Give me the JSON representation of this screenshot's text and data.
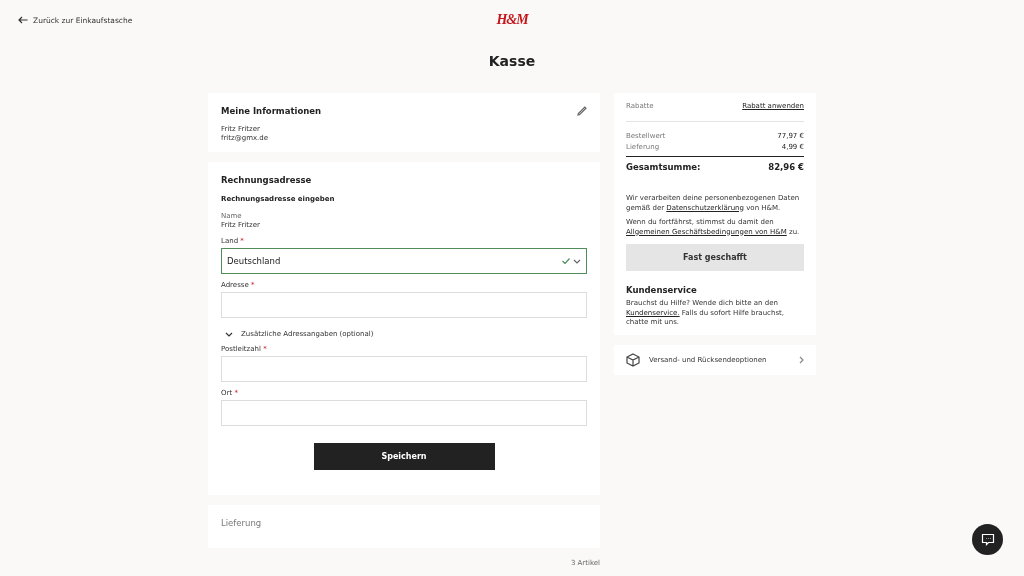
{
  "header": {
    "back_link": "Zurück zur Einkaufstasche",
    "logo": "H&M"
  },
  "page_title": "Kasse",
  "my_info": {
    "title": "Meine Informationen",
    "name": "Fritz Fritzer",
    "email": "fritz@gmx.de"
  },
  "billing": {
    "title": "Rechnungsadresse",
    "subtitle": "Rechnungsadresse eingeben",
    "name_label": "Name",
    "name_value": "Fritz Fritzer",
    "fields": [
      {
        "kind": "select",
        "label": "Land",
        "required_mark": "*",
        "value": "Deutschland",
        "valid": true
      },
      {
        "kind": "text",
        "label": "Adresse",
        "required_mark": "*"
      },
      {
        "kind": "toggle",
        "label": "Zusätzliche Adressangaben (optional)",
        "expanded": false
      },
      {
        "kind": "text",
        "label": "Postleitzahl",
        "required_mark": "*"
      },
      {
        "kind": "text",
        "label": "Ort",
        "required_mark": "*"
      }
    ],
    "save_button": "Speichern"
  },
  "delivery": {
    "title": "Lieferung"
  },
  "order_items": {
    "count": "3 Artikel"
  },
  "summary": {
    "discount_label": "Rabatte",
    "discount_link": "Rabatt anwenden",
    "lines": [
      {
        "label": "Bestellwert",
        "value": "77,97 €"
      },
      {
        "label": "Lieferung",
        "value": "4,99 €"
      }
    ],
    "total_label": "Gesamtsumme:",
    "total_value": "82,96 €",
    "notes": [
      [
        {
          "text": "Wir verarbeiten deine personenbezogenen Daten gemäß der "
        },
        {
          "text": "Datenschutzerklärung",
          "link": true
        },
        {
          "text": " von H&M."
        }
      ],
      [
        {
          "text": "Wenn du fortfährst, stimmst du damit den "
        },
        {
          "text": "Allgemeinen Geschäftsbedingungen von H&M",
          "link": true
        },
        {
          "text": " zu."
        }
      ]
    ],
    "continue_button": "Fast geschafft",
    "service_title": "Kundenservice",
    "service_text": [
      {
        "text": "Brauchst du Hilfe? Wende dich bitte an den "
      },
      {
        "text": "Kundenservice.",
        "link": true
      },
      {
        "text": " Falls du sofort Hilfe brauchst, chatte mit uns."
      }
    ]
  },
  "shipping_options": {
    "label": "Versand- und Rücksendeoptionen"
  }
}
